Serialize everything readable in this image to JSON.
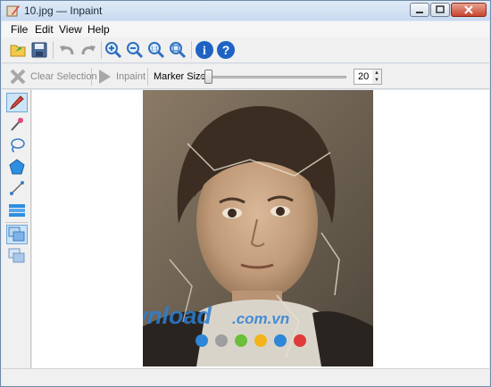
{
  "window": {
    "title": "10.jpg — Inpaint"
  },
  "menu": {
    "items": [
      "File",
      "Edit",
      "View",
      "Help"
    ]
  },
  "toolbar": {
    "buttons": [
      "open",
      "save",
      "undo",
      "redo",
      "zoom-in",
      "zoom-out",
      "zoom-actual",
      "zoom-fit",
      "info",
      "help"
    ]
  },
  "options": {
    "clear_selection_label": "Clear Selection",
    "inpaint_label": "Inpaint",
    "marker_size_label": "Marker Size",
    "marker_size_value": "20",
    "marker_size_min": 1,
    "marker_size_max": 100
  },
  "tools": [
    "marker",
    "magic-wand",
    "lasso",
    "polygon",
    "line",
    "guide-lines",
    "multi-view",
    "layers"
  ],
  "watermark": {
    "text": "Download",
    "suffix": ".com.vn",
    "dot_colors": [
      "#2e86d6",
      "#9e9e9e",
      "#6bbf3a",
      "#f2b41b",
      "#2e86d6",
      "#e03b3b"
    ]
  },
  "colors": {
    "accent": "#2f6fbf",
    "selection": "#cde4f7"
  }
}
